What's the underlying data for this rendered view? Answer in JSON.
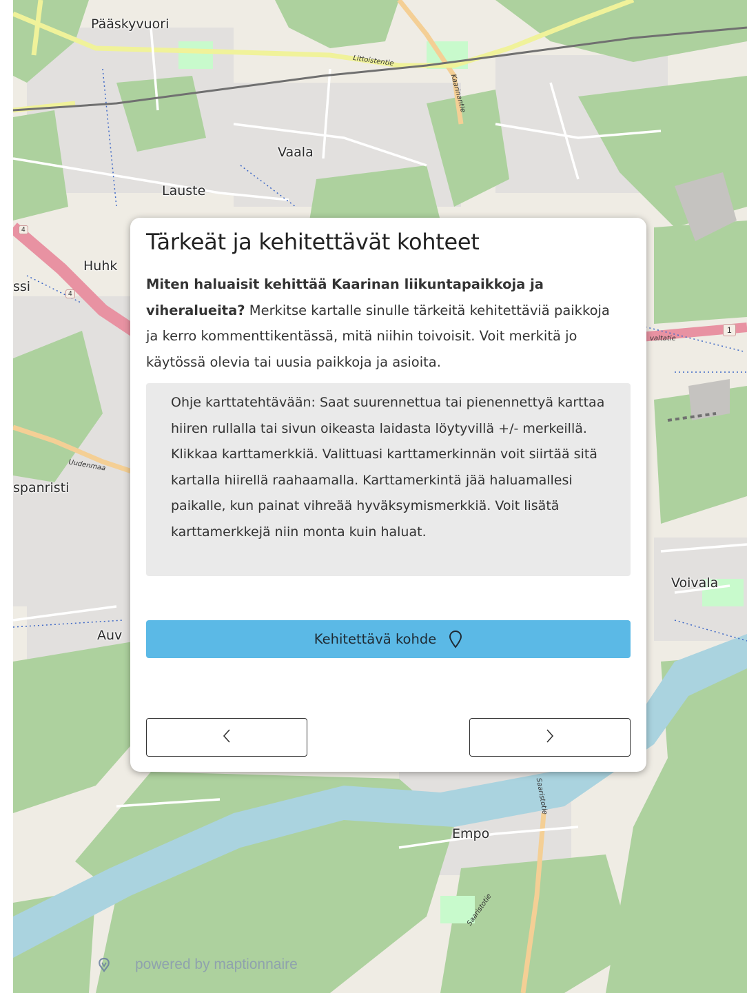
{
  "map": {
    "places": {
      "paaskyvuori": "Pääskyvuori",
      "vaala": "Vaala",
      "lauste": "Lauste",
      "huhk": "Huhk",
      "ssi": "ssi",
      "spanristi": "spanristi",
      "auv": "Auv",
      "voivala": "Voivala",
      "empo": "Empo"
    },
    "roads": {
      "littoistentie": "Littoistentie",
      "kaarinantie": "Kaarinantie",
      "uudenmaa": "Uudenmaa",
      "valtatie": "valtatie",
      "saaristotie_upper": "Saaristotie",
      "saaristotie_lower": "Saaristotie"
    },
    "shields": {
      "road_1": "1",
      "road_4a": "4",
      "road_4b": "4"
    },
    "colors": {
      "background": "#efece4",
      "forest": "#add19e",
      "water": "#aad3df",
      "residential": "#e0dfdf",
      "motorway": "#e892a2",
      "primary_road": "#fcd6a4",
      "secondary_road": "#f7fabf",
      "railway": "#707070"
    }
  },
  "dialog": {
    "title": "Tärkeät ja kehitettävät kohteet",
    "intro_bold": "Miten haluaisit kehittää Kaarinan liikuntapaikkoja ja viheralueita?",
    "intro_rest": " Merkitse kartalle sinulle tärkeitä kehitettäviä paikkoja ja kerro kommenttikentässä, mitä niihin toivoisit. Voit merkitä jo käytössä olevia tai uusia paikkoja ja asioita.",
    "instructions": "Ohje karttatehtävään: Saat suurennettua tai pienennettyä karttaa hiiren rullalla tai sivun oikeasta laidasta löytyvillä +/- merkeillä. Klikkaa karttamerkkiä. Valittuasi karttamerkinnän voit siirtää sitä kartalla hiirellä raahaamalla. Karttamerkintä jää haluamallesi paikalle, kun painat vihreää hyväksymismerkkiä. Voit lisätä karttamerkkejä niin monta kuin haluat.",
    "marker_button_label": "Kehitettävä kohde",
    "marker_icon": "map-pin-icon",
    "prev_icon": "chevron-left-icon",
    "next_icon": "chevron-right-icon",
    "button_color": "#5bb9e6"
  },
  "footer": {
    "powered_by": "powered by maptionnaire",
    "logo_icon": "maptionnaire-logo-icon"
  }
}
